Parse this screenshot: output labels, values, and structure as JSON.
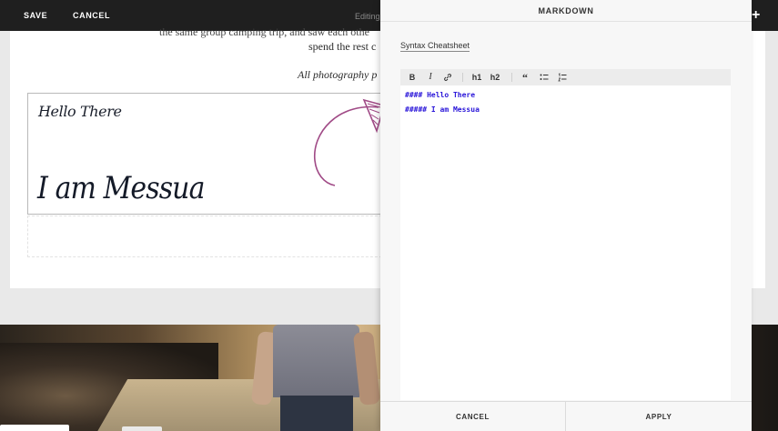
{
  "topbar": {
    "save_label": "SAVE",
    "cancel_label": "CANCEL",
    "editing_label": "Editing",
    "add_label": "+"
  },
  "page": {
    "cut_line": "the same group camping trip, and saw each othe",
    "body_line": "spend the rest c",
    "credit": "All photography p",
    "handwritten_small": "Hello There",
    "handwritten_large": "I am Messua"
  },
  "panel": {
    "title": "MARKDOWN",
    "cheatsheet_link": "Syntax Cheatsheet",
    "toolbar": {
      "bold": "B",
      "italic": "I",
      "link_icon": "link-icon",
      "h1": "h1",
      "h2": "h2",
      "quote": "“",
      "bullet_list_icon": "bullet-list-icon",
      "numbered_list_icon": "numbered-list-icon"
    },
    "editor_lines": [
      "#### Hello There",
      "##### I am Messua"
    ],
    "cancel_label": "CANCEL",
    "apply_label": "APPLY"
  },
  "colors": {
    "topbar_bg": "#1f1f1f",
    "markdown_text": "#2a16d9",
    "arrow": "#a04a86"
  }
}
